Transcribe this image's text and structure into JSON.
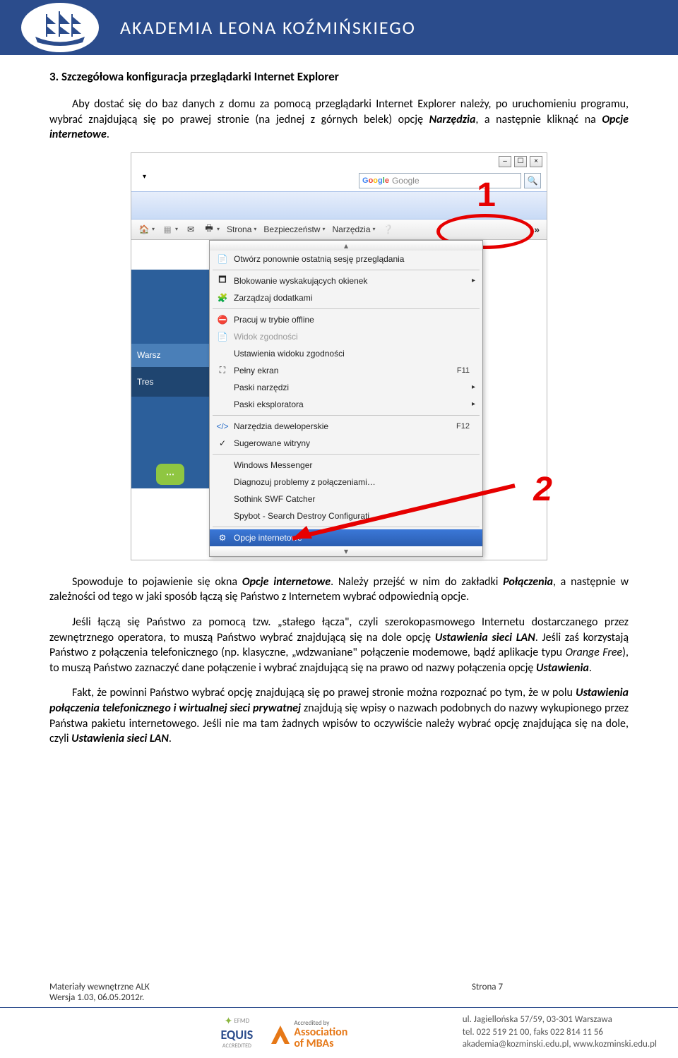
{
  "header": {
    "title": "AKADEMIA LEONA KOŹMIŃSKIEGO"
  },
  "section": {
    "title": "3. Szczegółowa konfiguracja przeglądarki Internet Explorer",
    "p1a": "Aby dostać się do baz danych z domu za pomocą przeglądarki Internet Explorer należy, po uruchomieniu programu, wybrać znajdującą się po prawej stronie (na jednej z górnych belek) opcję ",
    "p1b": ", a następnie kliknąć na ",
    "term_narzedzia": "Narzędzia",
    "term_opcje": "Opcje internetowe",
    "p2a": "Spowoduje to pojawienie się okna ",
    "p2b": ". Należy przejść w nim do zakładki ",
    "p2c": ", a następnie w zależności od tego w jaki sposób łączą się Państwo z Internetem wybrać odpowiednią opcje.",
    "term_polaczenia": "Połączenia",
    "p3a": "Jeśli łączą się Państwo za pomocą tzw. „stałego łącza\", czyli szerokopasmowego Internetu dostarczanego przez zewnętrznego operatora, to muszą Państwo wybrać znajdującą się na dole opcję ",
    "term_lan": "Ustawienia sieci LAN",
    "p3b": ". Jeśli zaś korzystają Państwo z połączenia telefonicznego (np. klasyczne, „wdzwaniane\" połączenie modemowe, bądź aplikacje typu ",
    "term_orange": "Orange Free",
    "p3c": "), to muszą Państwo zaznaczyć dane połączenie i wybrać znajdującą się na prawo od nazwy połączenia opcję ",
    "term_ustawienia": "Ustawienia",
    "p4a": "Fakt, że powinni Państwo wybrać opcję znajdującą się po prawej stronie można rozpoznać po tym, że w polu ",
    "term_dialup": "Ustawienia połączenia telefonicznego i wirtualnej sieci prywatnej",
    "p4b": " znajdują się wpisy o nazwach podobnych do nazwy wykupionego przez Państwa pakietu internetowego. Jeśli nie ma tam żadnych wpisów to oczywiście należy wybrać opcję znajdująca się na dole, czyli ",
    "term_lan2": "Ustawienia sieci LAN",
    "dot": "."
  },
  "screenshot": {
    "search_placeholder": "Google",
    "toolbar": {
      "strona": "Strona",
      "bezpieczenstwo": "Bezpieczeństw",
      "narzedzia": "Narzędzia"
    },
    "menu": [
      "Otwórz ponownie ostatnią sesję przeglądania",
      "Blokowanie wyskakujących okienek",
      "Zarządzaj dodatkami",
      "Pracuj w trybie offline",
      "Widok zgodności",
      "Ustawienia widoku zgodności",
      "Pełny ekran",
      "Paski narzędzi",
      "Paski eksploratora",
      "Narzędzia deweloperskie",
      "Sugerowane witryny",
      "Windows Messenger",
      "Diagnozuj problemy z połączeniami…",
      "Sothink SWF Catcher",
      "Spybot - Search Destroy Configurati",
      "Opcje internetowe"
    ],
    "shortcuts": {
      "fullscreen": "F11",
      "devtools": "F12"
    },
    "left_labels": {
      "warsz": "Warsz",
      "tres": "Tres"
    },
    "markers": {
      "one": "1",
      "two": "2"
    }
  },
  "footer": {
    "left1": "Materiały wewnętrzne ALK",
    "left2": "Wersja 1.03, 06.05.2012r.",
    "page": "Strona 7",
    "accred": {
      "efmd": "EFMD",
      "equis": "EQUIS",
      "equis_sub": "ACCREDITED",
      "mba1": "Accredited by",
      "mba2": "Association",
      "mba3": "of MBAs"
    },
    "contact": {
      "addr": "ul. Jagiellońska 57/59, 03-301 Warszawa",
      "tel": "tel. 022 519 21 00, faks 022 814 11 56",
      "email": "akademia@kozminski.edu.pl, www.kozminski.edu.pl"
    }
  }
}
